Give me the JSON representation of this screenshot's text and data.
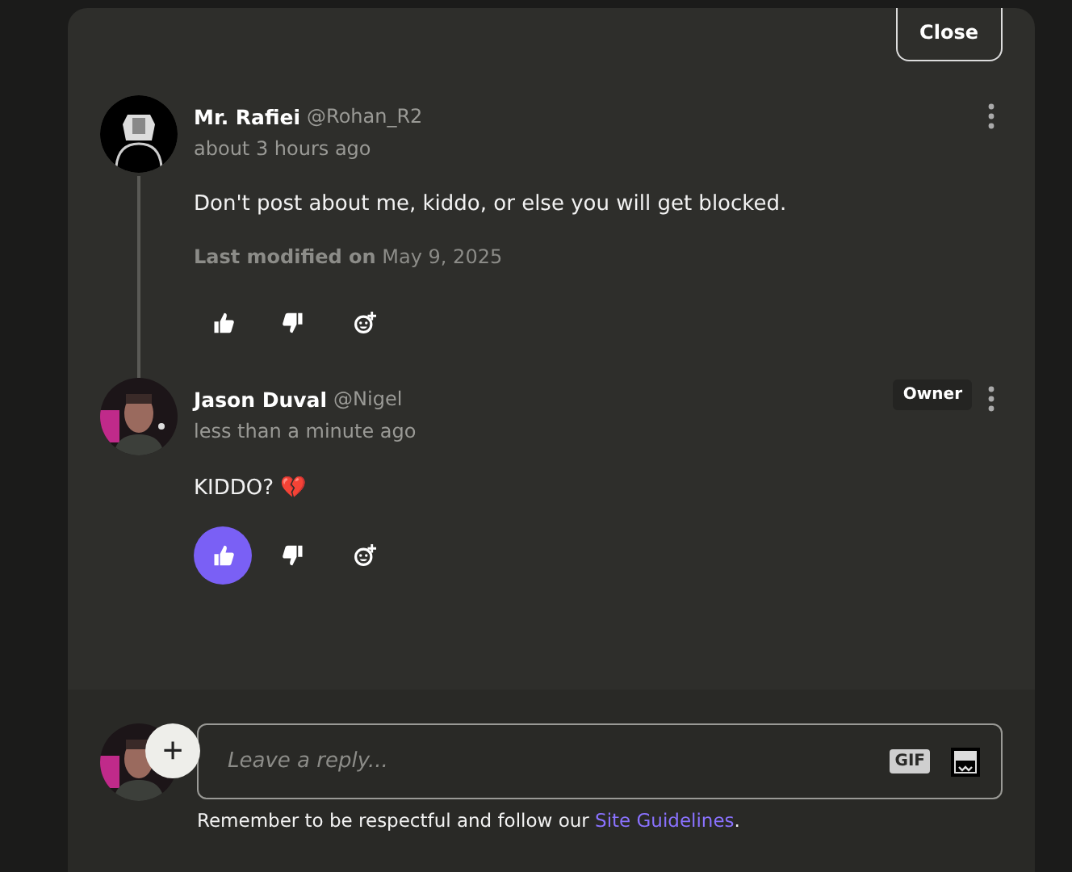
{
  "close_button": "Close",
  "comments": [
    {
      "name": "Mr. Rafiei",
      "handle": "@Rohan_R2",
      "time": "about 3 hours ago",
      "body": "Don't post about me, kiddo, or else you will get blocked.",
      "modified_label": "Last modified on",
      "modified_date": "May 9, 2025",
      "liked": false,
      "thread_line": true
    },
    {
      "name": "Jason Duval",
      "handle": "@Nigel",
      "time": "less than a minute ago",
      "badge": "Owner",
      "body": "KIDDO?",
      "emoji": "💔",
      "liked": true,
      "thread_line": false
    }
  ],
  "reply": {
    "placeholder": "Leave a reply...",
    "gif": "GIF",
    "add": "+"
  },
  "notice": {
    "text": "Remember to be respectful and follow our ",
    "link": "Site Guidelines",
    "end": "."
  }
}
